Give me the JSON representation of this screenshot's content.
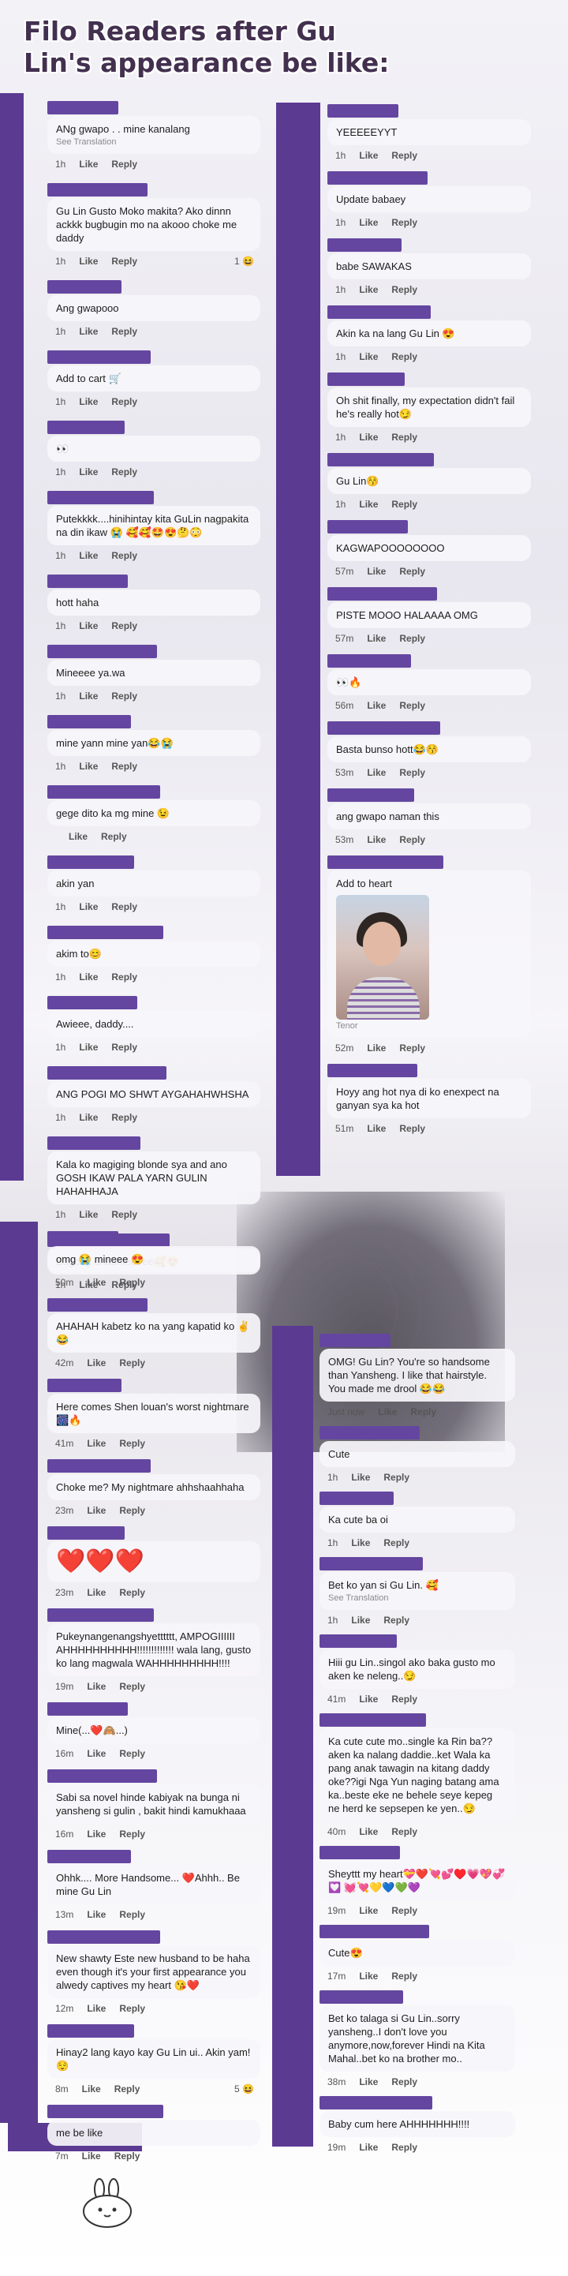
{
  "title": "Filo Readers after Gu Lin's appearance be like:",
  "labels": {
    "like": "Like",
    "reply": "Reply",
    "see_translation": "See Translation",
    "tenor": "Tenor"
  },
  "left_col1": [
    {
      "text": "ANg gwapo . . mine kanalang",
      "sub": "See Translation",
      "time": "1h"
    },
    {
      "text": "Gu Lin Gusto Moko makita? Ako dinnn ackkk bugbugin mo na akooo choke me daddy",
      "time": "1h",
      "react": "1 😆"
    },
    {
      "text": "Ang gwapooo",
      "time": "1h"
    },
    {
      "text": "Add to cart 🛒",
      "time": "1h"
    },
    {
      "text": "👀",
      "time": "1h"
    },
    {
      "text": "Putekkkk....hinihintay kita GuLin nagpakita na din ikaw 😭 🥰🥰🤩😍🤔😳",
      "time": "1h"
    },
    {
      "text": "hott haha",
      "time": "1h"
    },
    {
      "text": "Mineeee ya.wa",
      "time": "1h"
    },
    {
      "text": "mine yann mine yan😂😭",
      "time": "1h"
    },
    {
      "text": "gege dito ka mg mine 😉",
      "time": ""
    },
    {
      "text": "akin yan",
      "time": "1h"
    },
    {
      "text": "akim to😊",
      "time": "1h"
    },
    {
      "text": "Awieee, daddy....",
      "time": "1h"
    },
    {
      "text": "ANG POGI MO SHWT AYGAHAHWHSHA",
      "time": "1h"
    },
    {
      "text": "Kala ko magiging blonde sya and ano GOSH IKAW PALA YARN GULIN HAHAHHAJA",
      "time": "1h"
    },
    {
      "text": "Bagong dhadhieeeee🥰😍",
      "time": "1h"
    }
  ],
  "right_col1": [
    {
      "text": "YEEEEEYYT",
      "time": "1h"
    },
    {
      "text": "Update babaey",
      "time": "1h"
    },
    {
      "text": "babe SAWAKAS",
      "time": "1h"
    },
    {
      "text": "Akin ka na lang Gu Lin 😍",
      "time": "1h"
    },
    {
      "text": "Oh shit finally, my expectation didn't fail he's really hot😏",
      "time": "1h"
    },
    {
      "text": "Gu Lin😚",
      "time": "1h"
    },
    {
      "text": "KAGWAPOOOOOOOO",
      "time": "57m"
    },
    {
      "text": "PISTE MOOO HALAAAA OMG",
      "time": "57m"
    },
    {
      "text": "👀🔥",
      "time": "56m"
    },
    {
      "text": "Basta bunso hott😂😚",
      "time": "53m"
    },
    {
      "text": "ang gwapo naman this",
      "time": "53m"
    },
    {
      "text": "Add to heart",
      "time": "52m",
      "has_photo": true
    },
    {
      "text": "Hoyy ang hot nya di ko enexpect na ganyan sya ka hot",
      "time": "51m"
    }
  ],
  "left_col2": [
    {
      "text": "omg 😭 mineee 😍",
      "time": "50m"
    },
    {
      "text": "AHAHAH kabetz ko na yang kapatid ko ✌😂",
      "time": "42m"
    },
    {
      "text": "Here comes Shen louan's worst nightmare🎆🔥",
      "time": "41m"
    },
    {
      "text": "Choke me? My nightmare ahhshaahhaha",
      "time": "23m"
    },
    {
      "text": "❤️❤️❤️",
      "time": "23m",
      "big": true
    },
    {
      "text": "Pukeynangenangshyetttttt, AMPOGIIIIII AHHHHHHHHHH!!!!!!!!!!!!! wala lang, gusto ko lang magwala WAHHHHHHHHH!!!!",
      "time": "19m"
    },
    {
      "text": "Mine(...❤️🙈...)",
      "time": "16m"
    },
    {
      "text": "Sabi sa novel hinde kabiyak na bunga ni yansheng si gulin , bakit hindi kamukhaaa",
      "time": "16m"
    },
    {
      "text": "Ohhk.... More Handsome... ❤️Ahhh.. Be mine Gu Lin",
      "time": "13m"
    },
    {
      "text": "New shawty Este new husband to be haha even though it's your first appearance you alwedy captives my heart 😘❤️",
      "time": "12m"
    },
    {
      "text": "Hinay2 lang kayo kay Gu Lin ui.. Akin yam! 😌",
      "time": "8m",
      "react": "5 😆"
    },
    {
      "text": "me be like",
      "time": "7m"
    }
  ],
  "right_col2": [
    {
      "text": "OMG! Gu Lin? You're so handsome than Yansheng. I like that hairstyle. You made me drool 😂😂",
      "time": "Just now"
    },
    {
      "text": "Cute",
      "time": "1h"
    },
    {
      "text": "Ka cute ba oi",
      "time": "1h"
    },
    {
      "text": "Bet ko yan si Gu Lin. 🥰",
      "sub": "See Translation",
      "time": "1h"
    },
    {
      "text": "Hiii gu Lin..singol ako baka gusto mo aken ke neleng..😏",
      "time": "41m"
    },
    {
      "text": "Ka cute cute mo..single ka Rin ba??aken ka nalang daddie..ket Wala ka pang anak tawagin na kitang daddy oke??igi Nga Yun naging batang ama ka..beste eke ne behele seye kepeg ne herd ke sepsepen ke yen..😏",
      "time": "40m"
    },
    {
      "text": "Sheyttt my heart💝❤️💘💕♥️💗💖💞💟 💓💘💛💙💚💜",
      "time": "19m"
    },
    {
      "text": "Cute😍",
      "time": "17m"
    },
    {
      "text": "Bet ko talaga si Gu Lin..sorry yansheng..I don't love you anymore,now,forever Hindi na Kita Mahal..bet ko na brother mo..",
      "time": "38m"
    },
    {
      "text": "Baby cum here AHHHHHHH!!!!",
      "time": "19m"
    }
  ]
}
